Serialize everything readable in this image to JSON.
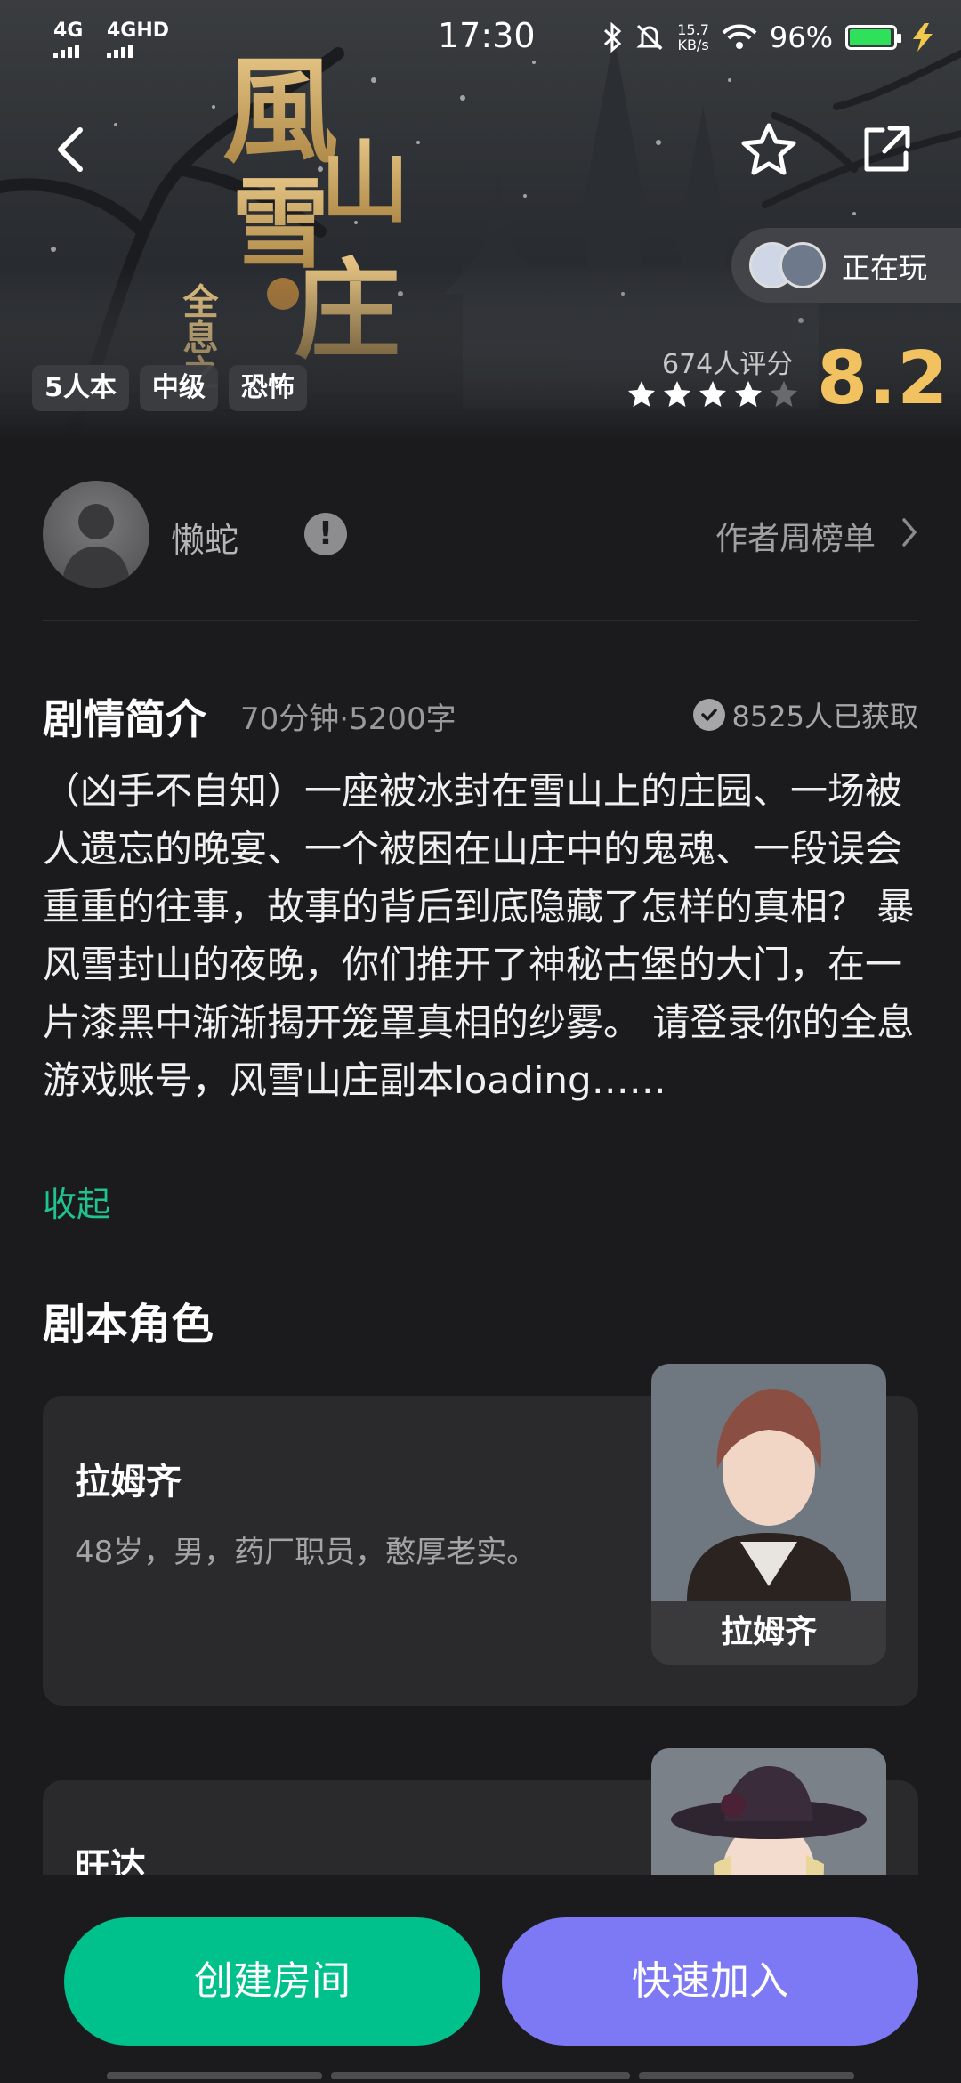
{
  "status_bar": {
    "network_1": "4G",
    "network_2": "4GHD",
    "time": "17:30",
    "speed_value": "15.7",
    "speed_unit": "KB/s",
    "battery": "96%",
    "battery_level": 0.96,
    "battery_color": "#2ee05a"
  },
  "hero": {
    "title_art": "風雪山庄",
    "subtitle_art": "全息之",
    "tags": [
      "5人本",
      "中级",
      "恐怖"
    ],
    "now_playing": "正在玩",
    "rating_count": "674人评分",
    "rating_score": "8.2",
    "stars_filled": 4,
    "stars_total": 5,
    "score_color": "#f2c160"
  },
  "author": {
    "name": "懒蛇",
    "badge": "!",
    "weekly_link": "作者周榜单"
  },
  "synopsis": {
    "heading": "剧情简介",
    "meta": "70分钟·5200字",
    "obtained": "8525人已获取",
    "text": "（凶手不自知）一座被冰封在雪山上的庄园、一场被人遗忘的晚宴、一个被困在山庄中的鬼魂、一段误会重重的往事，故事的背后到底隐藏了怎样的真相？ 暴风雪封山的夜晚，你们推开了神秘古堡的大门，在一片漆黑中渐渐揭开笼罩真相的纱雾。 请登录你的全息游戏账号，风雪山庄副本loading……",
    "collapse": "收起",
    "link_color": "#21c38c"
  },
  "roles": {
    "heading": "剧本角色",
    "items": [
      {
        "name": "拉姆齐",
        "desc": "48岁，男，药厂职员，憨厚老实。",
        "portrait_label": "拉姆齐"
      },
      {
        "name": "旺达",
        "desc": "",
        "portrait_label": ""
      }
    ]
  },
  "actions": {
    "create": "创建房间",
    "join": "快速加入",
    "create_color": "#00c08b",
    "join_color": "#7d79f5"
  },
  "icons": [
    "back-icon",
    "star-outline-icon",
    "share-icon",
    "bluetooth-icon",
    "mute-icon",
    "wifi-icon",
    "battery-icon",
    "charging-icon",
    "exclamation-icon",
    "chevron-right-icon",
    "check-circle-icon",
    "star-icon"
  ]
}
